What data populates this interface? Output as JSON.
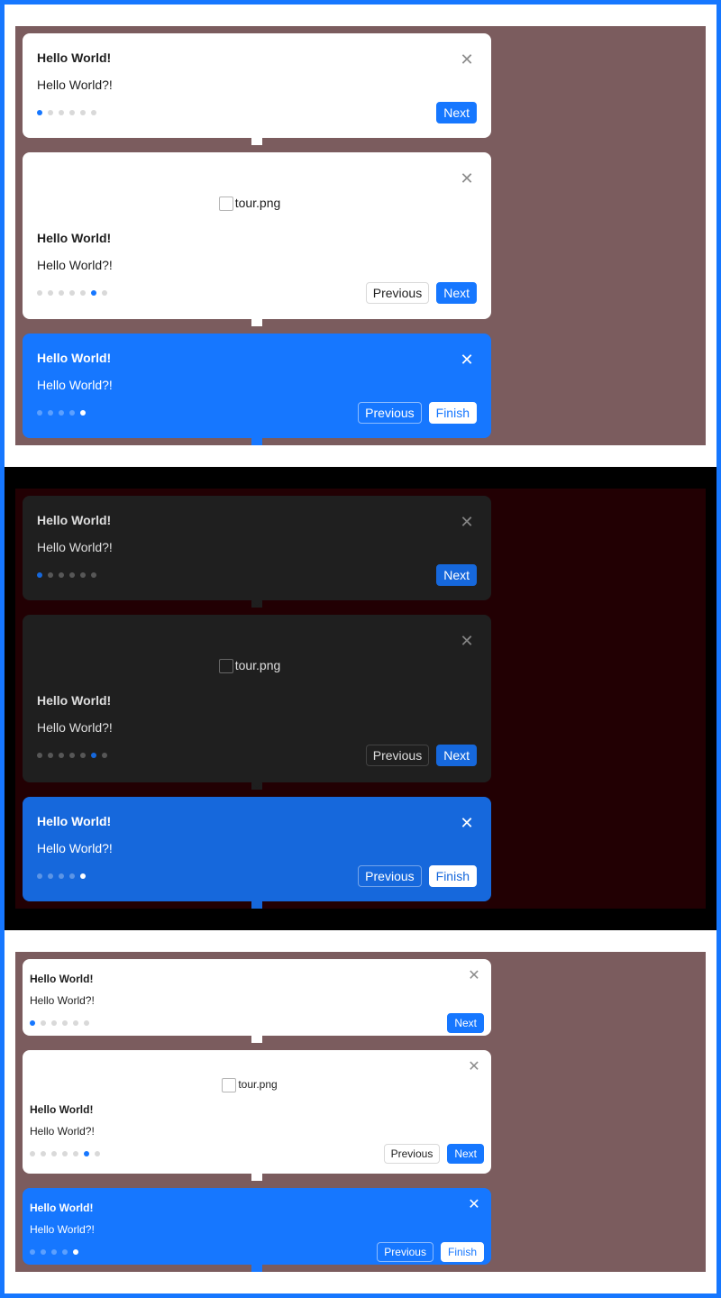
{
  "tour": {
    "title": "Hello World!",
    "description": "Hello World?!",
    "cover_alt": "tour.png",
    "close_icon": "close-icon",
    "next_label": "Next",
    "prev_label": "Previous",
    "finish_label": "Finish"
  },
  "colors": {
    "primary": "#1677ff",
    "dark_primary": "#1668dc",
    "stage_light": "#7b5c5e",
    "stage_dark": "#220003"
  },
  "steps": {
    "first": {
      "current": 1,
      "total": 6
    },
    "middle": {
      "current": 6,
      "total": 7
    },
    "last": {
      "current": 5,
      "total": 5
    }
  }
}
